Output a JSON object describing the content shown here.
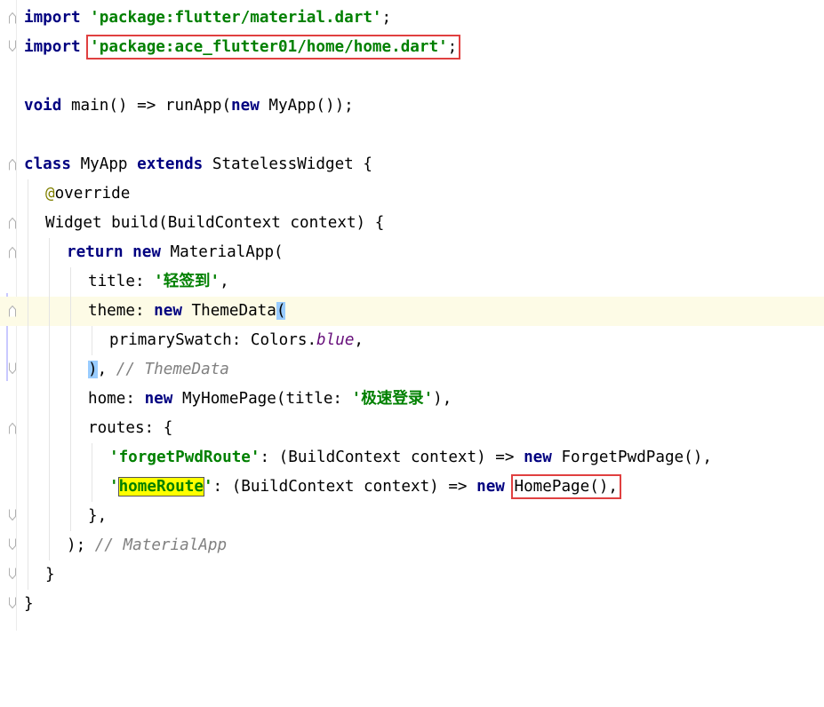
{
  "colors": {
    "keyword": "#000080",
    "string": "#008000",
    "comment": "#808080",
    "annotation": "#808000",
    "field": "#660e7a",
    "current_line_bg": "#fdfbe6",
    "brace_match": "#99ccff",
    "search_highlight": "#ffff00",
    "callout_box": "#e04040"
  },
  "code": {
    "l1": {
      "kw": "import",
      "str": "'package:flutter/material.dart'",
      "semi": ";"
    },
    "l2": {
      "kw": "import",
      "str": "'package:ace_flutter01/home/home.dart'",
      "semi": ";"
    },
    "l4": {
      "kw_void": "void",
      "sig": "main() => runApp(",
      "kw_new": "new",
      "rest": "MyApp());"
    },
    "l6": {
      "kw_class": "class",
      "name": "MyApp",
      "kw_extends": "extends",
      "rest": "StatelessWidget {"
    },
    "l7": {
      "at": "@",
      "ann": "override"
    },
    "l8": {
      "text": "Widget build(BuildContext context) {"
    },
    "l9": {
      "kw_return": "return",
      "kw_new": "new",
      "rest": "MaterialApp("
    },
    "l10": {
      "key": "title: ",
      "str": "'轻签到'",
      "end": ","
    },
    "l11": {
      "key": "theme: ",
      "kw_new": "new",
      "cls": "ThemeData",
      "paren": "("
    },
    "l12": {
      "key": "primarySwatch: Colors.",
      "field": "blue",
      "end": ","
    },
    "l13": {
      "paren": ")",
      "sep": ", ",
      "comment": "// ThemeData"
    },
    "l14": {
      "key": "home: ",
      "kw_new": "new",
      "mid": "MyHomePage(title: ",
      "str": "'极速登录'",
      "end": "),"
    },
    "l15": {
      "text": "routes: {"
    },
    "l16": {
      "str": "'forgetPwdRoute'",
      "mid": ": (BuildContext context) => ",
      "kw_new": "new",
      "rest": "ForgetPwdPage(),"
    },
    "l17": {
      "q1": "'",
      "hl": "homeRoute",
      "q2": "'",
      "mid": ": (BuildContext context) => ",
      "kw_new": "new",
      "boxed": "HomePage(),",
      "after": ""
    },
    "l18": {
      "text": "},"
    },
    "l19": {
      "text": "); ",
      "comment": "// MaterialApp"
    },
    "l20": {
      "text": "}"
    },
    "l21": {
      "text": "}"
    }
  }
}
